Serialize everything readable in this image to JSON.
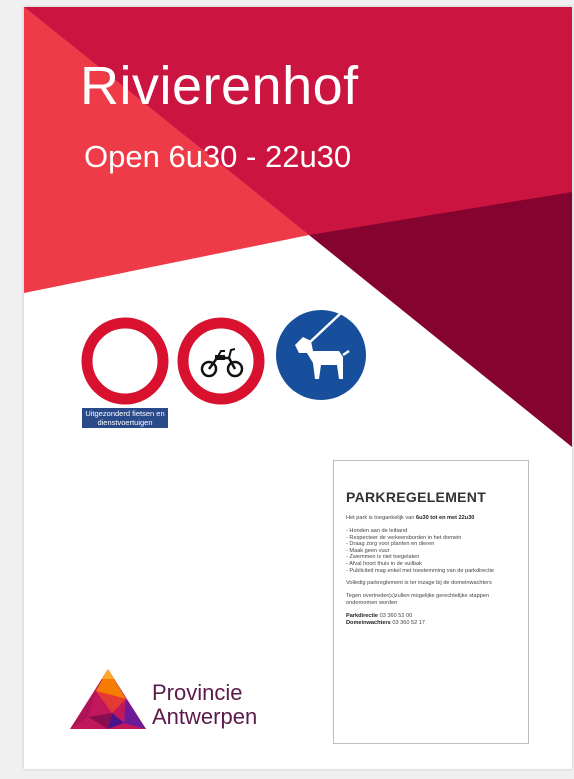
{
  "poster": {
    "title": "Rivierenhof",
    "subtitle": "Open 6u30 - 22u30"
  },
  "signs": {
    "caption": "Uitgezonderd fietsen en dienstvoertuigen",
    "items": [
      "no-vehicles-icon",
      "no-mopeds-icon",
      "dogs-on-leash-icon"
    ]
  },
  "rules": {
    "heading": "PARKREGELEMENT",
    "intro_prefix": "Het park is toegankelijk van",
    "intro_hours": "6u30 tot en met 22u30",
    "list": [
      "- Honden aan de leiband",
      "- Respecteer de verkeersborden in het domein",
      "- Draag zorg voor planten en dieren",
      "- Maak geen vuur",
      "- Zwemmen is niet toegelaten",
      "- Afval hoort thuis in de vuilbak",
      "- Publiciteit mag enkel met toestemming van de parkdirectie"
    ],
    "note": "Volledig parkreglement is ter inzage bij de domeinwachters",
    "warning": "Tegen overtreder(s)zullen mogelijke gerechtelijke stappen ondernomen worden",
    "contacts": [
      {
        "label": "Parkdirectie",
        "number": "03 360 52 00"
      },
      {
        "label": "Domeinwachters",
        "number": "03 360 52 17"
      }
    ]
  },
  "logo": {
    "line1": "Provincie",
    "line2": "Antwerpen"
  },
  "colors": {
    "red": "#ef3a47",
    "crimson": "#cc1440",
    "maroon": "#84042f",
    "sign_red": "#d8112f",
    "sign_blue": "#174f9c",
    "brand_purple": "#5a1a4a"
  }
}
